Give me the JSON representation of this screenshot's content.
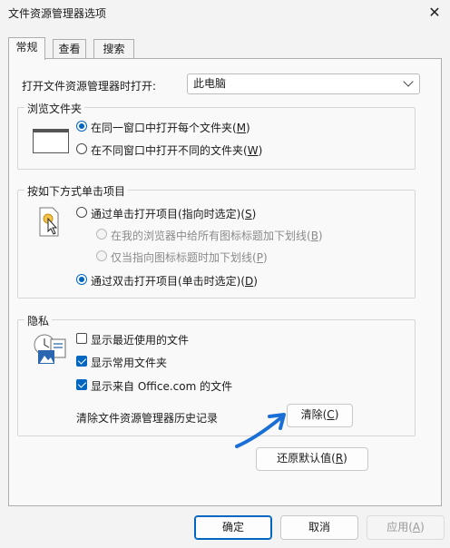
{
  "window": {
    "title": "文件资源管理器选项",
    "close_glyph": "✕"
  },
  "tabs": [
    {
      "label": "常规",
      "active": true
    },
    {
      "label": "查看",
      "active": false
    },
    {
      "label": "搜索",
      "active": false
    }
  ],
  "open_explorer": {
    "label": "打开文件资源管理器时打开:",
    "value": "此电脑"
  },
  "browse_folders": {
    "legend": "浏览文件夹",
    "options": [
      {
        "text": "在同一窗口中打开每个文件夹(",
        "key": "M",
        "tail": ")",
        "selected": true
      },
      {
        "text": "在不同窗口中打开不同的文件夹(",
        "key": "W",
        "tail": ")",
        "selected": false
      }
    ]
  },
  "click_items": {
    "legend": "按如下方式单击项目",
    "single": {
      "text": "通过单击打开项目(指向时选定)(",
      "key": "S",
      "tail": ")",
      "selected": false
    },
    "sub1": {
      "text": "在我的浏览器中给所有图标标题加下划线(",
      "key": "B",
      "tail": ")",
      "enabled": false
    },
    "sub2": {
      "text": "仅当指向图标标题时加下划线(",
      "key": "P",
      "tail": ")",
      "enabled": false
    },
    "double": {
      "text": "通过双击打开项目(单击时选定)(",
      "key": "D",
      "tail": ")",
      "selected": true
    }
  },
  "privacy": {
    "legend": "隐私",
    "recent_files": {
      "label": "显示最近使用的文件",
      "checked": false
    },
    "frequent_folders": {
      "label": "显示常用文件夹",
      "checked": true
    },
    "office_files": {
      "label": "显示来自 Office.com 的文件",
      "checked": true
    },
    "clear_label": "清除文件资源管理器历史记录",
    "clear_button": {
      "text": "清除(",
      "key": "C",
      "tail": ")"
    }
  },
  "restore_defaults": {
    "text": "还原默认值(",
    "key": "R",
    "tail": ")"
  },
  "footer": {
    "ok": "确定",
    "cancel": "取消",
    "apply": {
      "text": "应用(",
      "key": "A",
      "tail": ")"
    }
  },
  "colors": {
    "accent": "#0067c0",
    "annotation_arrow": "#1a6fd6"
  }
}
